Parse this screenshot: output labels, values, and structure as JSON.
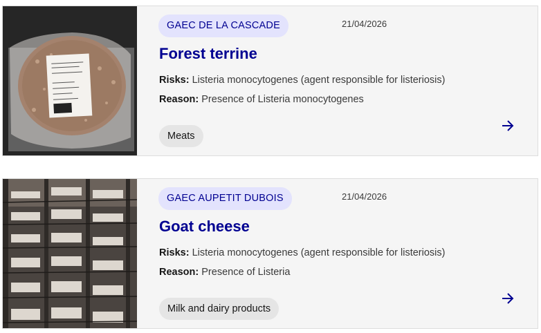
{
  "recalls": [
    {
      "producer": "GAEC DE LA CASCADE",
      "date": "21/04/2026",
      "title": "Forest terrine",
      "risks_label": "Risks:",
      "risks": "Listeria monocytogenes (agent responsible for listeriosis)",
      "reason_label": "Reason:",
      "reason": "Presence of Listeria monocytogenes",
      "category": "Meats",
      "image": "vacuum-packed-terrine-photo"
    },
    {
      "producer": "GAEC AUPETIT DUBOIS",
      "date": "21/04/2026",
      "title": "Goat cheese",
      "risks_label": "Risks:",
      "risks": "Listeria monocytogenes (agent responsible for listeriosis)",
      "reason_label": "Reason:",
      "reason": "Presence of Listeria",
      "category": "Milk and dairy products",
      "image": "cheese-drying-rack-photo"
    }
  ],
  "icons": {
    "open": "arrow-right-icon"
  },
  "colors": {
    "accent": "#000091",
    "badge_bg": "#e3e3fd",
    "card_bg": "#f5f5f5",
    "tag_bg": "#e5e5e5"
  }
}
